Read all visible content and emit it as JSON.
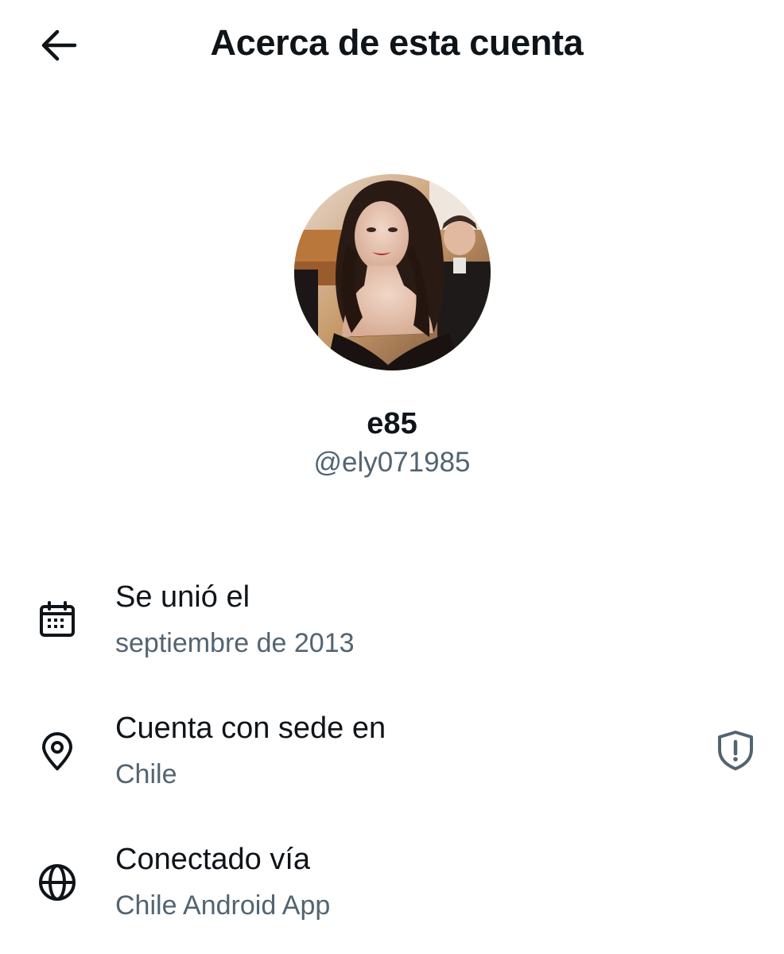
{
  "header": {
    "title": "Acerca de esta cuenta",
    "back_icon": "arrow-left-icon"
  },
  "profile": {
    "display_name": "e85",
    "handle": "@ely071985"
  },
  "info": {
    "joined": {
      "icon": "calendar-icon",
      "label": "Se unió el",
      "value": "septiembre de 2013"
    },
    "location": {
      "icon": "location-pin-icon",
      "label": "Cuenta con sede en",
      "value": "Chile",
      "badge_icon": "shield-alert-icon"
    },
    "connected": {
      "icon": "globe-icon",
      "label": "Conectado vía",
      "value": "Chile Android App"
    }
  },
  "colors": {
    "text_primary": "#0f1419",
    "text_secondary": "#536471",
    "background": "#ffffff"
  }
}
